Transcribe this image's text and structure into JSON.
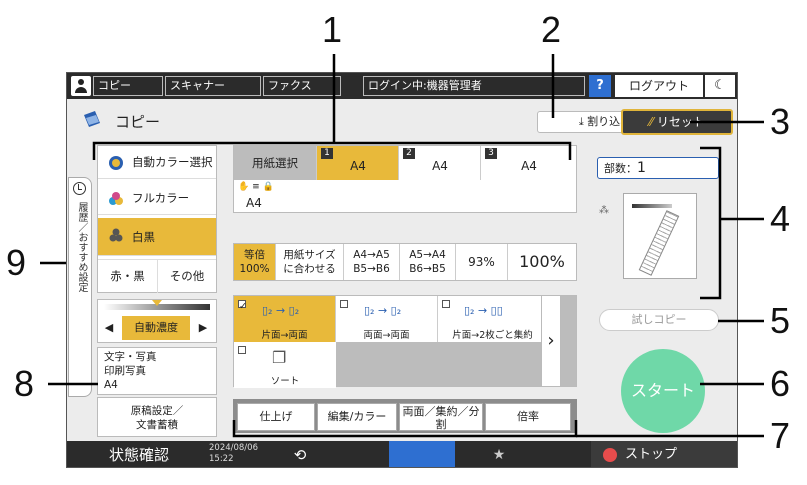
{
  "topbar": {
    "tabs": [
      "コピー",
      "スキャナー",
      "ファクス"
    ],
    "login": "ログイン中:機器管理者",
    "help": "?",
    "logout": "ログアウト",
    "sleep": "☾"
  },
  "header": {
    "title": "コピー",
    "interrupt": "割り込み",
    "reset": "リセット"
  },
  "history_tab": "履歴／おすすめ設定",
  "color_modes": {
    "auto": "自動カラー選択",
    "full": "フルカラー",
    "bw": "白黒",
    "redblack": "赤・黒",
    "other": "その他"
  },
  "density": {
    "label": "自動濃度",
    "left": "◀",
    "right": "▶"
  },
  "original_type": {
    "line1": "文字・写真",
    "line2": "印刷写真",
    "line3": "A4"
  },
  "original_settings": {
    "line1": "原稿設定／",
    "line2": "文書蓄積"
  },
  "paper": {
    "label": "用紙選択",
    "trays": [
      {
        "num": "1",
        "size": "A4"
      },
      {
        "num": "2",
        "size": "A4"
      },
      {
        "num": "3",
        "size": "A4"
      }
    ],
    "bypass": "A4"
  },
  "ratio": {
    "same_1": "等倍",
    "same_2": "100%",
    "fit_1": "用紙サイズ",
    "fit_2": "に合わせる",
    "a4a5_1": "A4→A5",
    "a4a5_2": "B5→B6",
    "a5a4_1": "A5→A4",
    "a5a4_2": "B6→B5",
    "r93": "93%",
    "r100": "100%"
  },
  "duplex": {
    "one_two": "片面→両面",
    "two_two": "両面→両面",
    "combine": "片面→2枚ごと集約",
    "sort": "ソート"
  },
  "bottom_tabs": [
    "仕上げ",
    "編集/カラー",
    "両面／集約／分割",
    "倍率"
  ],
  "copies": {
    "label": "部数：",
    "value": "1"
  },
  "trial": "試しコピー",
  "start": "スタート",
  "statusbar": {
    "status": "状態確認",
    "date": "2024/08/06",
    "time": "15:22",
    "stop": "ストップ"
  },
  "callouts": [
    "1",
    "2",
    "3",
    "4",
    "5",
    "6",
    "7",
    "8",
    "9"
  ]
}
